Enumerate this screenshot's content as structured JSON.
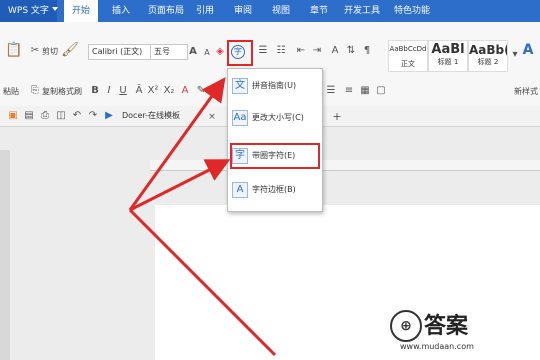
{
  "menubar": {
    "app_title": "WPS 文字",
    "tabs": [
      "开始",
      "插入",
      "页面布局",
      "引用",
      "审阅",
      "视图",
      "章节",
      "开发工具",
      "特色功能"
    ]
  },
  "ribbon": {
    "paste_label": "粘贴",
    "cut_label": "剪切",
    "copy_label": "复制",
    "format_painter_label": "格式刷",
    "font_name": "Calibri (正文)",
    "font_size": "五号",
    "styles": [
      {
        "preview": "AaBbCcDd",
        "name": "正文"
      },
      {
        "preview": "AaBl",
        "name": "标题 1"
      },
      {
        "preview": "AaBb(",
        "name": "标题 2"
      }
    ],
    "new_style_label": "新样式"
  },
  "docbar": {
    "doc_tab_label": "Docer-在线模板"
  },
  "dropdown": {
    "items": [
      {
        "icon": "pinyin-guide-icon",
        "label": "拼音指南(U)"
      },
      {
        "icon": "change-case-icon",
        "label": "更改大小写(C)"
      },
      {
        "icon": "enclosed-char-icon",
        "label": "带圈字符(E)"
      },
      {
        "icon": "char-border-icon",
        "label": "字符边框(B)"
      }
    ]
  },
  "watermark": {
    "text": "答案",
    "url": "www.mudaan.com"
  },
  "colors": {
    "accent": "#2d6ecb",
    "highlight": "#e02828"
  }
}
